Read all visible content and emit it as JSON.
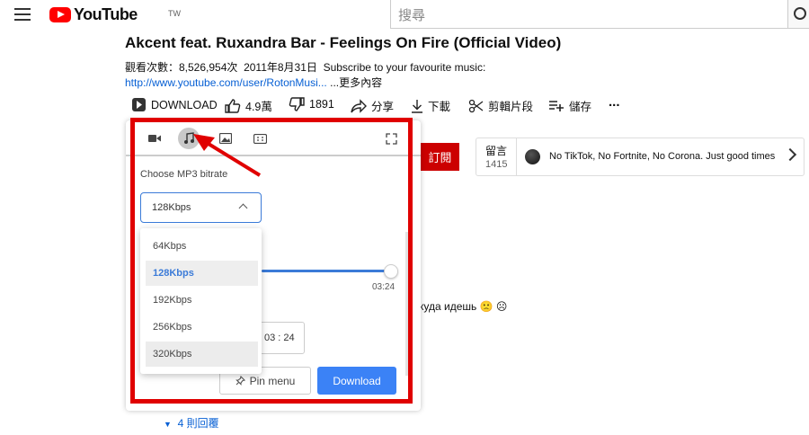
{
  "header": {
    "logo_text": "YouTube",
    "region": "TW",
    "search_placeholder": "搜尋"
  },
  "video": {
    "title": "Akcent feat. Ruxandra Bar - Feelings On Fire (Official Video)",
    "views": "觀看次數：8,526,954次",
    "date": "2011年8月31日",
    "description": "Subscribe to your favourite music:",
    "url": "http://www.youtube.com/user/RotonMusi...",
    "more": "...更多內容"
  },
  "actions": {
    "download": "DOWNLOAD",
    "likes": "4.9萬",
    "dislikes": "1891",
    "share": "分享",
    "download_zh": "下載",
    "clip": "剪輯片段",
    "save": "儲存",
    "more": "..."
  },
  "sidebar": {
    "subscribe": "訂閱",
    "comments_label": "留言",
    "comments_count": "1415",
    "top_comment": "No TikTok, No Fortnite, No Corona. Just good times"
  },
  "comments": {
    "cyrillic_text": "куда идешь 🙁 ☹",
    "replies": "4 則回覆"
  },
  "panel": {
    "choose_label": "Choose MP3 bitrate",
    "selected": "128Kbps",
    "options": [
      "64Kbps",
      "128Kbps",
      "192Kbps",
      "256Kbps",
      "320Kbps"
    ],
    "slider_fraction": 1.0,
    "end_time": "03:24",
    "time_input": "03 : 24",
    "pin_label": "Pin menu",
    "download_label": "Download",
    "accent": "#3b82f6"
  },
  "annotation": {
    "color": "#e00000"
  }
}
